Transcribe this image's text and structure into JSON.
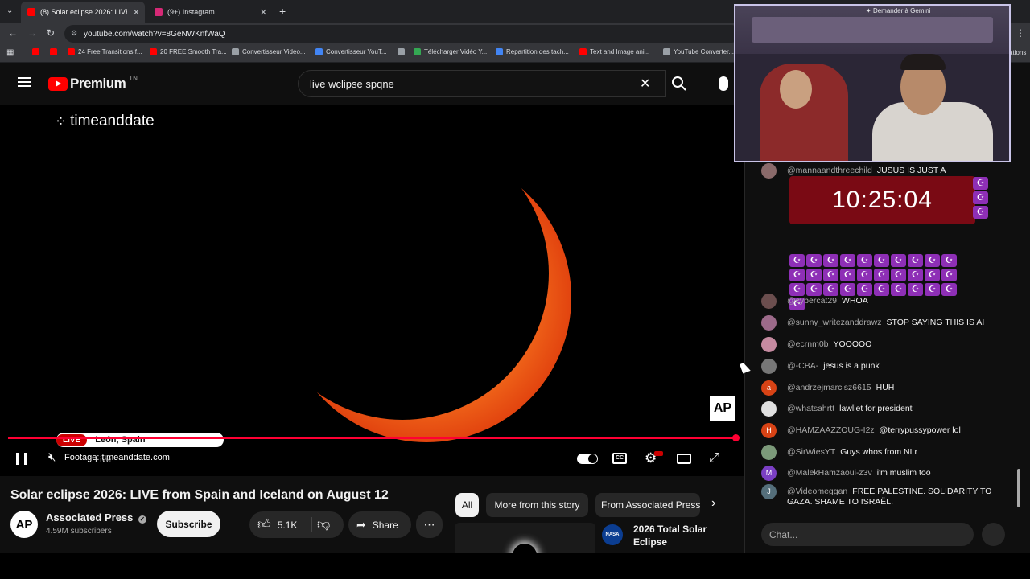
{
  "tabs": [
    {
      "label": "(8) Solar eclipse 2026: LIVE from",
      "active": true,
      "icon": "youtube-icon",
      "color": "#ff0000"
    },
    {
      "label": "(9+) Instagram",
      "active": false,
      "icon": "instagram-icon",
      "color": "#d62976"
    }
  ],
  "address": {
    "url": "youtube.com/watch?v=8GeNWKnfWaQ"
  },
  "bookmarks": [
    {
      "label": "",
      "icon": "youtube-icon"
    },
    {
      "label": "",
      "icon": "youtube-icon"
    },
    {
      "label": "24 Free Transitions f...",
      "icon": "youtube-icon"
    },
    {
      "label": "20 FREE Smooth Tra...",
      "icon": "youtube-icon"
    },
    {
      "label": "Convertisseur Video...",
      "icon": "globe-icon"
    },
    {
      "label": "Convertisseur YouT...",
      "icon": "converter-icon"
    },
    {
      "label": "",
      "icon": "globe-icon"
    },
    {
      "label": "Télécharger Vidéo Y...",
      "icon": "download-icon"
    },
    {
      "label": "Repartition des tach...",
      "icon": "docs-icon"
    },
    {
      "label": "Text and Image ani...",
      "icon": "youtube-icon"
    },
    {
      "label": "YouTube Converter...",
      "icon": "globe-icon"
    }
  ],
  "bookmarks_tail": "ations",
  "overlay": {
    "gemini": "Demander à Gemini"
  },
  "header": {
    "logo": "Premium",
    "logo_sup": "TN",
    "search_value": "live wclipse spqne"
  },
  "player": {
    "watermark": "timeanddate",
    "badge_live": "LIVE",
    "location": "León, Spain",
    "footage": "Footage: timeanddate.com",
    "live_text": "Live",
    "ap_logo": "AP",
    "progress": 1.0
  },
  "video": {
    "title": "Solar eclipse 2026: LIVE from Spain and Iceland on August 12",
    "channel": "Associated Press",
    "channel_avatar": "AP",
    "subscribers": "4.59M subscribers",
    "subscribe_label": "Subscribe",
    "likes": "5.1K",
    "share_label": "Share"
  },
  "chips": [
    "All",
    "More from this story",
    "From Associated Press"
  ],
  "related": {
    "title": "2026 Total Solar Eclipse",
    "channel_logo": "NASA"
  },
  "timer": "10:25:04",
  "chat": {
    "first": {
      "author": "@mannaandthreechild",
      "text": "JUSUS IS JUST A"
    },
    "messages": [
      {
        "author": "@cybercat29",
        "text": "WHOA",
        "avatar": "",
        "color": "#6b4e4e"
      },
      {
        "author": "@sunny_writezanddrawz",
        "text": "STOP SAYING THIS IS AI",
        "avatar": "",
        "color": "#9c6a8a"
      },
      {
        "author": "@ecrnm0b",
        "text": "YOOOOO",
        "avatar": "",
        "color": "#c58aa0"
      },
      {
        "author": "@-CBA-",
        "text": "jesus is a punk",
        "avatar": "",
        "color": "#777777"
      },
      {
        "author": "@andrzejmarcisz6615",
        "text": "HUH",
        "avatar": "a",
        "color": "#d84315"
      },
      {
        "author": "@whatsahrtt",
        "text": "lawliet for president",
        "avatar": "",
        "color": "#e0e0e0"
      },
      {
        "author": "@HAMZAAZZOUG-I2z",
        "text": "@terrypussypower lol",
        "avatar": "H",
        "color": "#d84315"
      },
      {
        "author": "@SirWiesYT",
        "text": "Guys whos from NLr",
        "avatar": "",
        "color": "#7c9a7a"
      },
      {
        "author": "@MalekHamzaoui-z3v",
        "text": "i'm muslim too",
        "avatar": "M",
        "color": "#7b3fc4"
      },
      {
        "author": "@Videomeggan",
        "text": "FREE PALESTINE. SOLIDARITY TO GAZA. SHAME TO ISRAËL.",
        "avatar": "J",
        "color": "#546e7a"
      }
    ],
    "input_placeholder": "Chat..."
  }
}
